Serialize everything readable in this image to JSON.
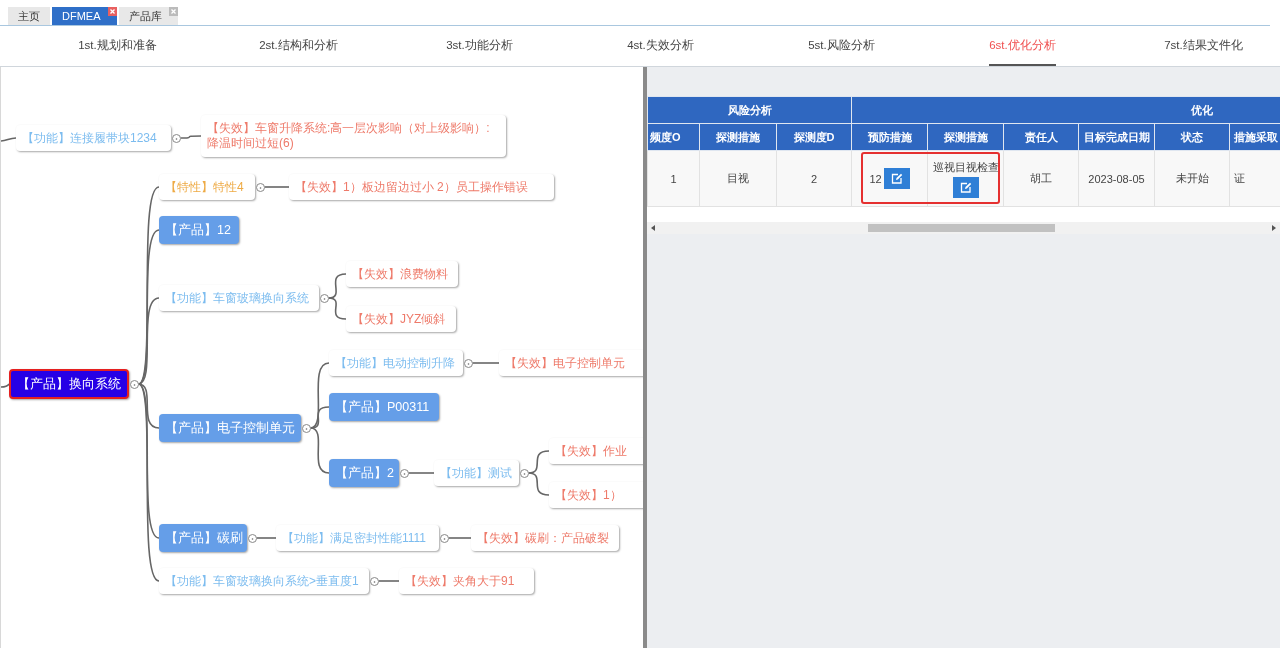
{
  "tabs": [
    {
      "label": "主页",
      "selected": false,
      "closable": false
    },
    {
      "label": "DFMEA",
      "selected": true,
      "closable": true
    },
    {
      "label": "产品库",
      "selected": false,
      "closable": true
    }
  ],
  "steps": [
    {
      "label": "1st.规划和准备",
      "selected": false
    },
    {
      "label": "2st.结构和分析",
      "selected": false
    },
    {
      "label": "3st.功能分析",
      "selected": false
    },
    {
      "label": "4st.失效分析",
      "selected": false
    },
    {
      "label": "5st.风险分析",
      "selected": false
    },
    {
      "label": "6st.优化分析",
      "selected": true
    },
    {
      "label": "7st.结果文件化",
      "selected": false
    }
  ],
  "mindmap": {
    "nodes": [
      {
        "kind": "function",
        "label": "【功能】连接履带块1234",
        "selected": false,
        "children": [
          {
            "kind": "failure",
            "label": "【失效】车窗升降系统:高一层次影响（对上级影响）:降温时间过短(6)",
            "selected": false
          }
        ]
      },
      {
        "kind": "product",
        "label": "【产品】换向系统",
        "selected": true,
        "children": [
          {
            "kind": "feature",
            "label": "【特性】特性4",
            "selected": false,
            "children": [
              {
                "kind": "failure",
                "label": "【失效】1）板边留边过小 2）员工操作错误",
                "selected": false
              }
            ]
          },
          {
            "kind": "product",
            "label": "【产品】12",
            "selected": false
          },
          {
            "kind": "function",
            "label": "【功能】车窗玻璃换向系统",
            "selected": false,
            "children": [
              {
                "kind": "failure",
                "label": "【失效】浪费物料",
                "selected": false
              },
              {
                "kind": "failure",
                "label": "【失效】JYZ倾斜",
                "selected": false
              }
            ]
          },
          {
            "kind": "product",
            "label": "【产品】电子控制单元",
            "selected": false,
            "children": [
              {
                "kind": "function",
                "label": "【功能】电动控制升降",
                "selected": false,
                "children": [
                  {
                    "kind": "failure",
                    "label": "【失效】电子控制单元",
                    "selected": false
                  }
                ]
              },
              {
                "kind": "product",
                "label": "【产品】P00311",
                "selected": false
              },
              {
                "kind": "product",
                "label": "【产品】2",
                "selected": false,
                "children": [
                  {
                    "kind": "function",
                    "label": "【功能】测试",
                    "selected": false,
                    "children": [
                      {
                        "kind": "failure",
                        "label": "【失效】作业",
                        "selected": false
                      },
                      {
                        "kind": "failure",
                        "label": "【失效】1）",
                        "selected": false
                      }
                    ]
                  }
                ]
              }
            ]
          },
          {
            "kind": "product",
            "label": "【产品】碳刷",
            "selected": false,
            "children": [
              {
                "kind": "function",
                "label": "【功能】满足密封性能1111",
                "selected": false,
                "children": [
                  {
                    "kind": "failure",
                    "label": "【失效】碳刷：产品破裂",
                    "selected": false
                  }
                ]
              }
            ]
          },
          {
            "kind": "function",
            "label": "【功能】车窗玻璃换向系统>垂直度1",
            "selected": false,
            "children": [
              {
                "kind": "failure",
                "label": "【失效】夹角大于91",
                "selected": false
              }
            ]
          }
        ]
      }
    ]
  },
  "table": {
    "groups": [
      {
        "label": "风险分析",
        "columns": [
          "频度O",
          "探测措施",
          "探测度D"
        ]
      },
      {
        "label": "优化",
        "columns": [
          "预防措施",
          "探测措施",
          "责任人",
          "目标完成日期",
          "状态",
          "措施采取"
        ]
      }
    ],
    "rows": [
      {
        "cells": [
          {
            "kind": "plain",
            "text": "1",
            "highlighted": false
          },
          {
            "kind": "plain",
            "text": "目视",
            "highlighted": false
          },
          {
            "kind": "plain",
            "text": "2",
            "highlighted": false
          },
          {
            "kind": "edit",
            "text": "12",
            "highlighted": true
          },
          {
            "kind": "edit",
            "text": "巡视目视检查",
            "highlighted": true
          },
          {
            "kind": "plain",
            "text": "胡工",
            "highlighted": false
          },
          {
            "kind": "plain",
            "text": "2023-08-05",
            "highlighted": false
          },
          {
            "kind": "plain",
            "text": "未开始",
            "highlighted": false
          },
          {
            "kind": "plain",
            "text": "证",
            "highlighted": false
          }
        ]
      }
    ]
  }
}
